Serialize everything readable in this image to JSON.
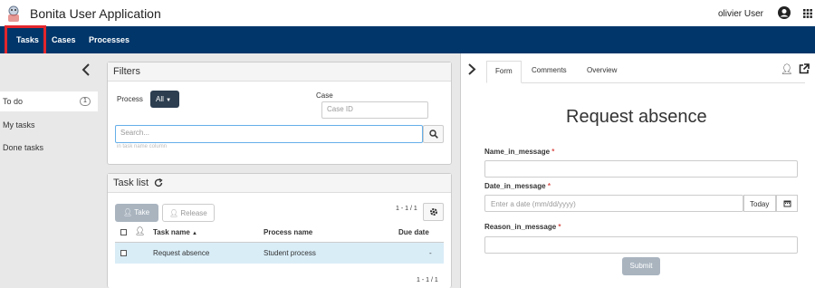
{
  "app": {
    "title": "Bonita User Application",
    "user_name": "olivier User"
  },
  "nav": {
    "tabs": [
      "Tasks",
      "Cases",
      "Processes"
    ]
  },
  "sidebar": {
    "items": [
      {
        "label": "To do",
        "count": "1"
      },
      {
        "label": "My tasks"
      },
      {
        "label": "Done tasks"
      }
    ]
  },
  "filters": {
    "title": "Filters",
    "process_label": "Process",
    "process_value": "All",
    "case_label": "Case",
    "case_placeholder": "Case ID",
    "search_placeholder": "Search...",
    "search_hint": "in task name column"
  },
  "task_list": {
    "title": "Task list",
    "take_label": "Take",
    "release_label": "Release",
    "pagination_top": "1 - 1 / 1",
    "pagination_bottom": "1 - 1 / 1",
    "columns": [
      "Task name",
      "Process name",
      "Due date"
    ],
    "rows": [
      {
        "task_name": "Request absence",
        "process_name": "Student process",
        "due_date": "-"
      }
    ]
  },
  "form_panel": {
    "tabs": [
      "Form",
      "Comments",
      "Overview"
    ],
    "form_title": "Request absence",
    "fields": [
      {
        "label": "Name_in_message",
        "required": "*"
      },
      {
        "label": "Date_in_message",
        "required": "*",
        "placeholder": "Enter a date (mm/dd/yyyy)",
        "today_label": "Today"
      },
      {
        "label": "Reason_in_message",
        "required": "*"
      }
    ],
    "submit_label": "Submit"
  },
  "colors": {
    "navbar": "#00366a",
    "highlight": "#e3262b",
    "selected_row": "#d9edf7"
  }
}
